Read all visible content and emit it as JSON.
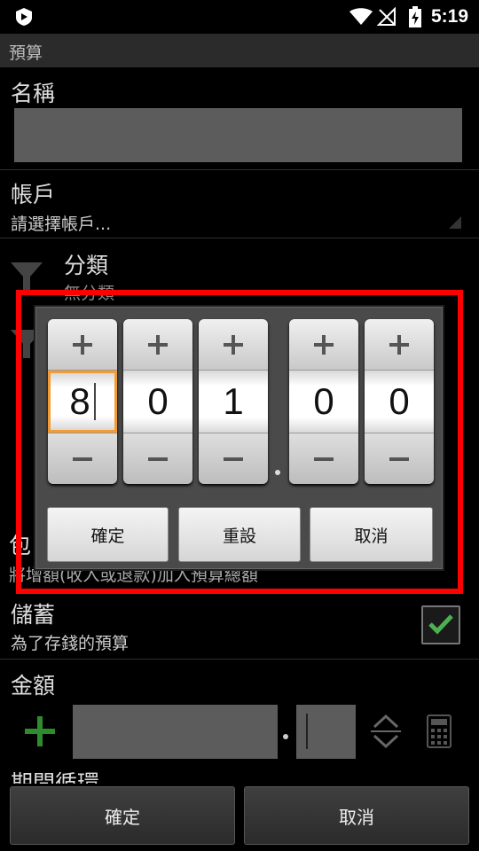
{
  "status_bar": {
    "time": "5:19"
  },
  "title_bar": {
    "title": "預算"
  },
  "form": {
    "name_label": "名稱",
    "account_label": "帳戶",
    "account_placeholder": "請選擇帳戶...",
    "category_label": "分類",
    "category_value": "無分類",
    "include_label": "包",
    "include_desc_partial": "將增額(收入或退款)加入預算總額",
    "save_label": "儲蓄",
    "save_desc": "為了存錢的預算",
    "amount_label": "金額",
    "period_label": "期間循環"
  },
  "bottom_buttons": {
    "confirm": "確定",
    "cancel": "取消"
  },
  "dialog": {
    "digits": [
      "8",
      "0",
      "1",
      "0",
      "0"
    ],
    "confirm": "確定",
    "reset": "重設",
    "cancel": "取消"
  },
  "colors": {
    "highlight": "#ff0000",
    "focus": "#f39c33",
    "check": "#4caf50"
  }
}
